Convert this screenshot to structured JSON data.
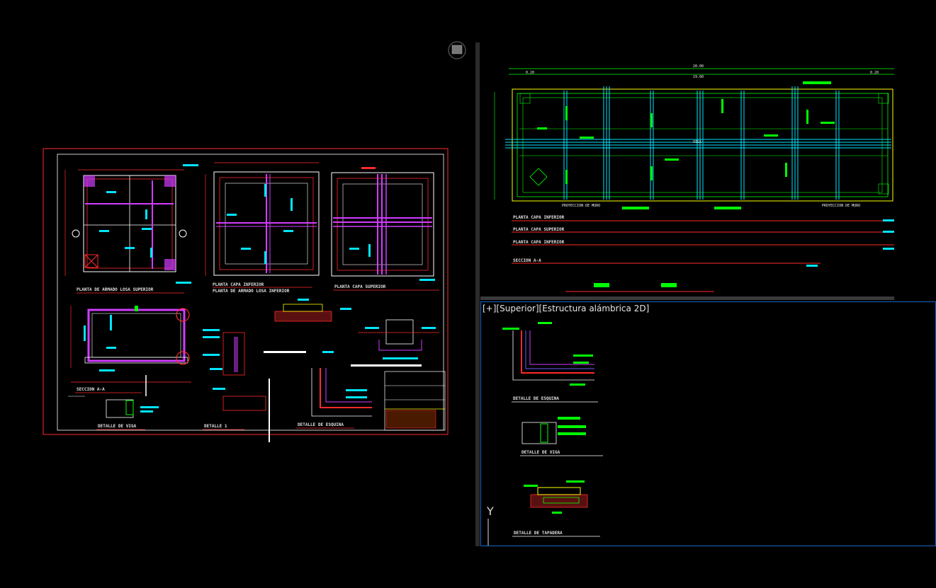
{
  "viewports": {
    "active_label": "[+][Superior][Estructura alámbrica 2D]"
  },
  "sheet_left": {
    "titles": {
      "planta_losa_superior": "PLANTA DE ARMADO LOSA SUPERIOR",
      "planta_capa_inferior": "PLANTA CAPA INFERIOR",
      "planta_losa_inferior": "PLANTA DE ARMADO LOSA INFERIOR",
      "planta_capa_superior": "PLANTA CAPA SUPERIOR",
      "seccion_aa": "SECCION A-A",
      "detalle_viga": "DETALLE DE VIGA",
      "detalle_1": "DETALLE 1",
      "detalle_esquina": "DETALLE DE ESQUINA"
    }
  },
  "sheet_top_right": {
    "dims": {
      "total": "20.00",
      "inner": "19.60",
      "side": "0.20"
    },
    "labels": {
      "proyeccion_left": "PROYECCION DE MURO",
      "proyeccion_right": "PROYECCION DE MURO",
      "viga": "VIGA",
      "row1": "PLANTA CAPA INFERIOR",
      "row2": "PLANTA CAPA SUPERIOR",
      "row3": "PLANTA CAPA INFERIOR",
      "row4": "SECCION A-A"
    }
  },
  "sheet_bottom_right": {
    "titles": {
      "detalle_esquina": "DETALLE DE ESQUINA",
      "detalle_viga": "DETALLE DE VIGA",
      "detalle_tapadera": "DETALLE DE TAPADERA"
    },
    "ucs_axis": "Y"
  },
  "colors": {
    "red": "#ff2a2a",
    "cyan": "#00e5ff",
    "green": "#00ff00",
    "magenta": "#d23cff",
    "yellow": "#ffff00",
    "white": "#ffffff",
    "viewport_border": "#1a63c7"
  }
}
